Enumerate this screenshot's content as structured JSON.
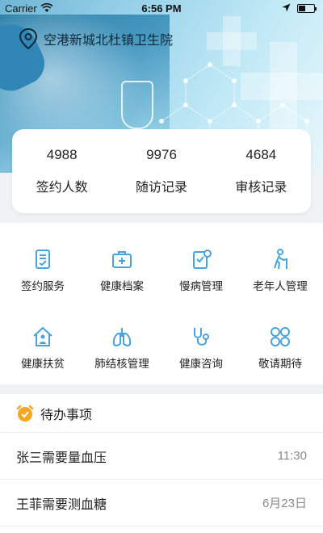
{
  "status_bar": {
    "carrier": "Carrier",
    "time": "6:56 PM"
  },
  "header": {
    "location_name": "空港新城北杜镇卫生院"
  },
  "stats": [
    {
      "value": "4988",
      "label": "签约人数"
    },
    {
      "value": "9976",
      "label": "随访记录"
    },
    {
      "value": "4684",
      "label": "审核记录"
    }
  ],
  "menu": [
    {
      "label": "签约服务",
      "icon": "contract-document-icon"
    },
    {
      "label": "健康档案",
      "icon": "medical-kit-icon"
    },
    {
      "label": "慢病管理",
      "icon": "chronic-disease-icon"
    },
    {
      "label": "老年人管理",
      "icon": "elderly-walking-icon"
    },
    {
      "label": "健康扶贫",
      "icon": "home-health-icon"
    },
    {
      "label": "肺结核管理",
      "icon": "lungs-icon"
    },
    {
      "label": "健康咨询",
      "icon": "stethoscope-icon"
    },
    {
      "label": "敬请期待",
      "icon": "more-grid-icon"
    }
  ],
  "todo": {
    "title": "待办事项",
    "items": [
      {
        "text": "张三需要量血压",
        "time": "11:30"
      },
      {
        "text": "王菲需要测血糖",
        "time": "6月23日"
      }
    ]
  },
  "colors": {
    "accent": "#4aa3d8",
    "todo_icon": "#f5a623"
  }
}
